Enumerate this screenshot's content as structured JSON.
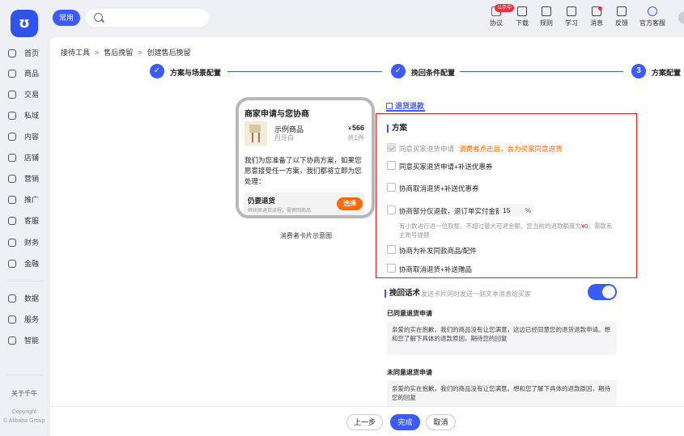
{
  "topbar": {
    "logo_icon": "qianniu-logo-icon",
    "chip": "常用",
    "search_placeholder": "",
    "badge": "公示中",
    "nav": [
      {
        "label": "协议",
        "icon": "agreement-icon"
      },
      {
        "label": "下载",
        "icon": "download-icon"
      },
      {
        "label": "规则",
        "icon": "rules-icon"
      },
      {
        "label": "学习",
        "icon": "learn-icon"
      },
      {
        "label": "消息",
        "icon": "message-icon"
      },
      {
        "label": "反馈",
        "icon": "feedback-icon"
      },
      {
        "label": "官方客服",
        "icon": "service-icon"
      }
    ]
  },
  "sidebar": {
    "items": [
      {
        "label": "首页",
        "icon": "home-icon"
      },
      {
        "label": "商品",
        "icon": "goods-icon"
      },
      {
        "label": "交易",
        "icon": "trade-icon"
      },
      {
        "label": "私域",
        "icon": "private-domain-icon"
      },
      {
        "label": "内容",
        "icon": "content-icon"
      },
      {
        "label": "店铺",
        "icon": "shop-icon"
      },
      {
        "label": "营销",
        "icon": "marketing-icon"
      },
      {
        "label": "推广",
        "icon": "promotion-icon"
      },
      {
        "label": "客服",
        "icon": "customer-service-icon"
      },
      {
        "label": "财务",
        "icon": "finance-icon"
      },
      {
        "label": "金融",
        "icon": "banking-icon"
      },
      {
        "label": "数据",
        "icon": "data-icon"
      },
      {
        "label": "服务",
        "icon": "services-icon"
      },
      {
        "label": "智能",
        "icon": "smart-icon"
      }
    ],
    "about": "关于千牛",
    "copyright_1": "Copyright",
    "copyright_2": "© Alibaba Group"
  },
  "breadcrumb": {
    "items": [
      "接待工具",
      "售后挽留",
      "创建售后挽留"
    ],
    "separator": ">"
  },
  "steps": [
    {
      "label": "方案与场景配置",
      "status": "done",
      "mark": "✓"
    },
    {
      "label": "挽回条件配置",
      "status": "done",
      "mark": "✓"
    },
    {
      "label": "方案配置",
      "status": "current",
      "mark": "3"
    }
  ],
  "preview": {
    "title": "商家申请与您协商",
    "product_name": "示例商品",
    "product_spec": "月牙白",
    "price_symbol": "¥",
    "price": "566",
    "count": "共1件",
    "message": "我们为您准备了以下协商方案，如果您愿意接受任一方案，我们都将立即为您处理：",
    "option_title": "仍要退货",
    "option_sub": "继续原退货流程，需寄回商品",
    "option_button": "选择",
    "caption": "消费者卡片示意图"
  },
  "tab": {
    "label": "退货退款",
    "icon": "shopping-bag-icon"
  },
  "plan": {
    "title": "方案",
    "options": [
      {
        "label": "同意买家退货申请",
        "note": "消费者点击后，会为买家同意退货",
        "checked": true,
        "disabled": true
      },
      {
        "label": "同意买家退货申请+补送优惠券",
        "checked": false
      },
      {
        "label": "协商取消退货+补送优惠券",
        "checked": false
      },
      {
        "label": "协商部分仅退款，退订单实付金额",
        "checked": false
      },
      {
        "label": "协商为补发同款商品/配件",
        "checked": false
      },
      {
        "label": "协商取消退货+补送赠品",
        "checked": false
      }
    ],
    "percent_value": "15",
    "percent_unit": "%",
    "hint_before": "有小数进行进一位取整，不超过最大可退金额，您当前的退款额度为",
    "hint_amount": "¥0",
    "hint_after": "，需联系主账号提额"
  },
  "retention": {
    "title": "挽回话术",
    "subtitle": "发送卡片同时发送一则文本消息给买家",
    "enabled": true,
    "agree_heading": "已同意退货申请",
    "agree_text": "亲爱的实在抱歉，我们的商品没有让您满意，这边已经同意您的退货退款申请。想和您了解下具体的退款原因，期待您的回复",
    "disagree_heading": "未同意退货申请",
    "disagree_text": "亲爱的实在抱歉，我们的商品没有让您满意。想和您了解下具体的退款原因，期待您的回复"
  },
  "footer": {
    "prev": "上一步",
    "done": "完成",
    "cancel": "取消"
  },
  "colors": {
    "accent": "#3b5bfd",
    "orange": "#ff6a00",
    "highlight": "#e61e1e"
  }
}
